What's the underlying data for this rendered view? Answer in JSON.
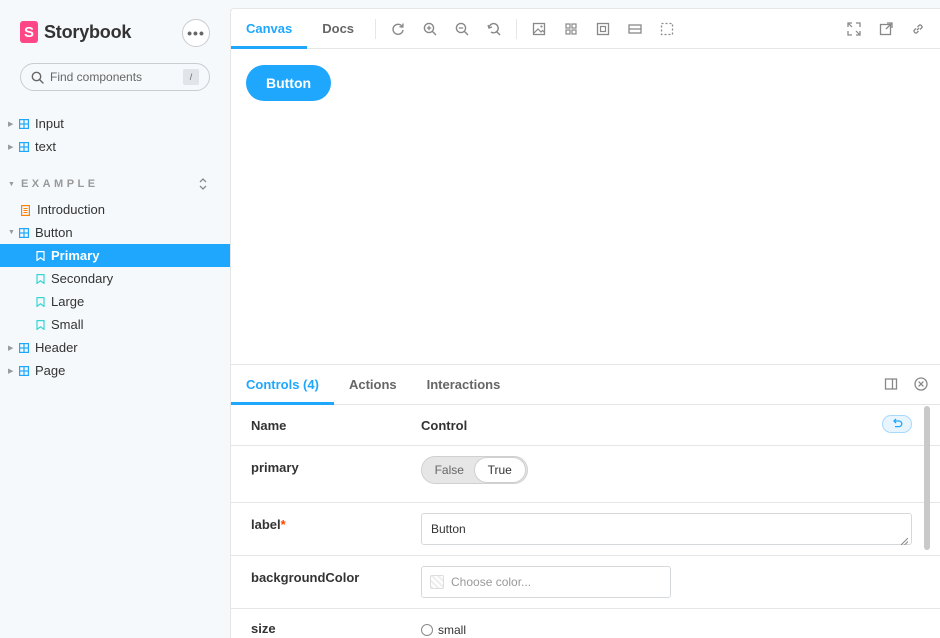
{
  "sidebar": {
    "brand": {
      "logo": "S",
      "name": "Storybook"
    },
    "menu_label": "•••",
    "search": {
      "placeholder": "Find components",
      "shortcut": "/"
    },
    "top_items": [
      {
        "label": "Input"
      },
      {
        "label": "text"
      }
    ],
    "section": {
      "title": "EXAMPLE"
    },
    "example_items": [
      {
        "label": "Introduction"
      },
      {
        "label": "Button"
      },
      {
        "label": "Primary"
      },
      {
        "label": "Secondary"
      },
      {
        "label": "Large"
      },
      {
        "label": "Small"
      },
      {
        "label": "Header"
      },
      {
        "label": "Page"
      }
    ]
  },
  "toolbar": {
    "tabs": [
      {
        "label": "Canvas"
      },
      {
        "label": "Docs"
      }
    ],
    "active_tab": "Canvas"
  },
  "canvas": {
    "button_label": "Button"
  },
  "addons": {
    "tabs": [
      {
        "label": "Controls (4)"
      },
      {
        "label": "Actions"
      },
      {
        "label": "Interactions"
      }
    ],
    "active_tab": "Controls (4)",
    "table": {
      "col_name": "Name",
      "col_control": "Control",
      "rows": [
        {
          "name": "primary",
          "toggle": {
            "off": "False",
            "on": "True",
            "value": "True"
          }
        },
        {
          "name": "label",
          "required_mark": "*",
          "value": "Button"
        },
        {
          "name": "backgroundColor",
          "placeholder": "Choose color..."
        },
        {
          "name": "size",
          "radio_first": "small"
        }
      ]
    }
  },
  "colors": {
    "accent": "#1ea7fd",
    "brand": "#ff4785",
    "sidebar_bg": "#f6f9fc",
    "component_icon": "#1ea7fd",
    "story_icon": "#37d5d3",
    "docs_icon": "#ff8300"
  }
}
